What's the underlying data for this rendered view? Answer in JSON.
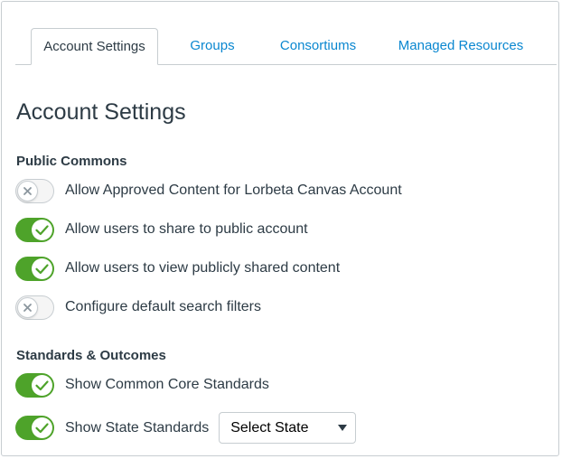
{
  "tabs": [
    {
      "label": "Account Settings",
      "active": true
    },
    {
      "label": "Groups",
      "active": false
    },
    {
      "label": "Consortiums",
      "active": false
    },
    {
      "label": "Managed Resources",
      "active": false
    }
  ],
  "page_title": "Account Settings",
  "sections": [
    {
      "heading": "Public Commons",
      "settings": [
        {
          "label": "Allow Approved Content for Lorbeta Canvas Account",
          "enabled": false
        },
        {
          "label": "Allow users to share to public account",
          "enabled": true
        },
        {
          "label": "Allow users to view publicly shared content",
          "enabled": true
        },
        {
          "label": "Configure default search filters",
          "enabled": false
        }
      ]
    },
    {
      "heading": "Standards & Outcomes",
      "settings": [
        {
          "label": "Show Common Core Standards",
          "enabled": true
        },
        {
          "label": "Show State Standards",
          "enabled": true
        }
      ]
    }
  ],
  "state_select": {
    "value": "Select State",
    "icon": "caret-down-icon"
  },
  "colors": {
    "toggle_on": "#4ea32a",
    "toggle_off": "#f5f5f5",
    "link": "#0a87d0",
    "text": "#2d3b45",
    "border": "#c7cdd1"
  },
  "icons": {
    "on": "checkmark-icon",
    "off": "x-icon"
  }
}
